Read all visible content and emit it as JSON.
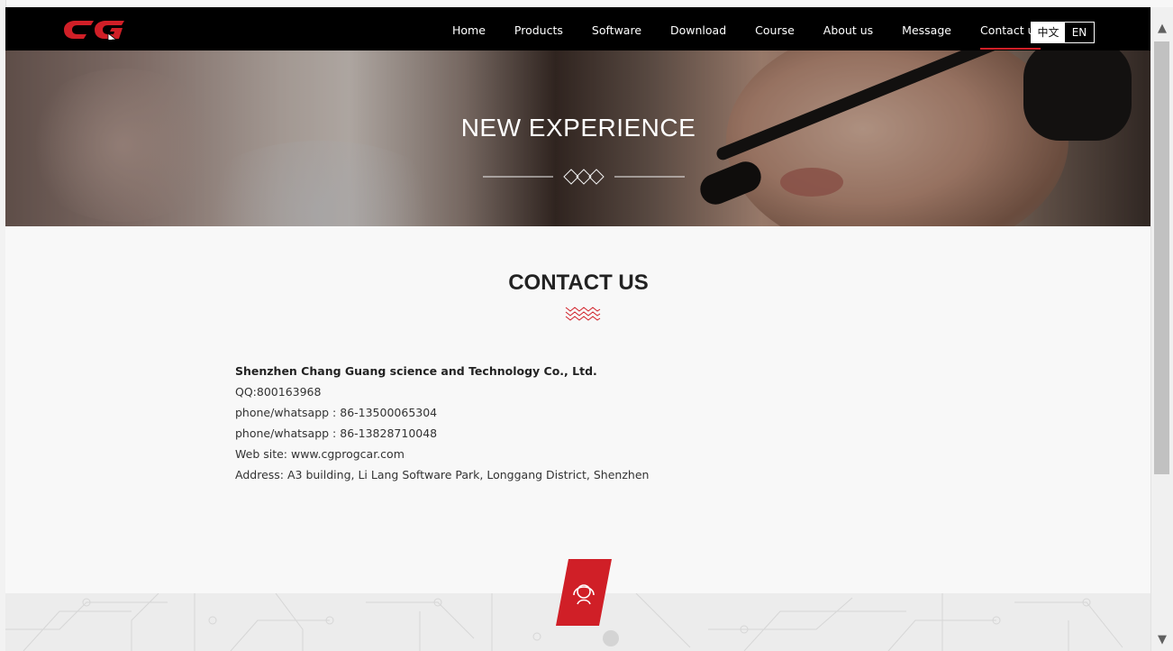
{
  "header": {
    "nav": [
      {
        "label": "Home"
      },
      {
        "label": "Products"
      },
      {
        "label": "Software"
      },
      {
        "label": "Download"
      },
      {
        "label": "Course"
      },
      {
        "label": "About us"
      },
      {
        "label": "Message"
      },
      {
        "label": "Contact us",
        "active": true
      }
    ],
    "lang_zh": "中文",
    "lang_en": "EN"
  },
  "hero": {
    "title": "NEW EXPERIENCE"
  },
  "contact": {
    "title": "CONTACT US",
    "company": "Shenzhen Chang Guang science and Technology Co., Ltd.",
    "qq": "QQ:800163968",
    "phone1": "phone/whatsapp : 86-13500065304",
    "phone2": "phone/whatsapp : 86-13828710048",
    "website": "Web site: www.cgprogcar.com",
    "address": "Address: A3 building, Li Lang Software Park, Longgang District, Shenzhen"
  },
  "colors": {
    "accent": "#d01f27",
    "header_bg": "#000000",
    "page_bg": "#f8f8f8"
  },
  "icons": {
    "logo": "cg-logo",
    "badge": "customer-service-icon",
    "divider": "diamond-ornament-icon",
    "zigzag": "zigzag-ornament-icon",
    "scroll_up": "chevron-up-icon",
    "scroll_down": "chevron-down-icon"
  }
}
